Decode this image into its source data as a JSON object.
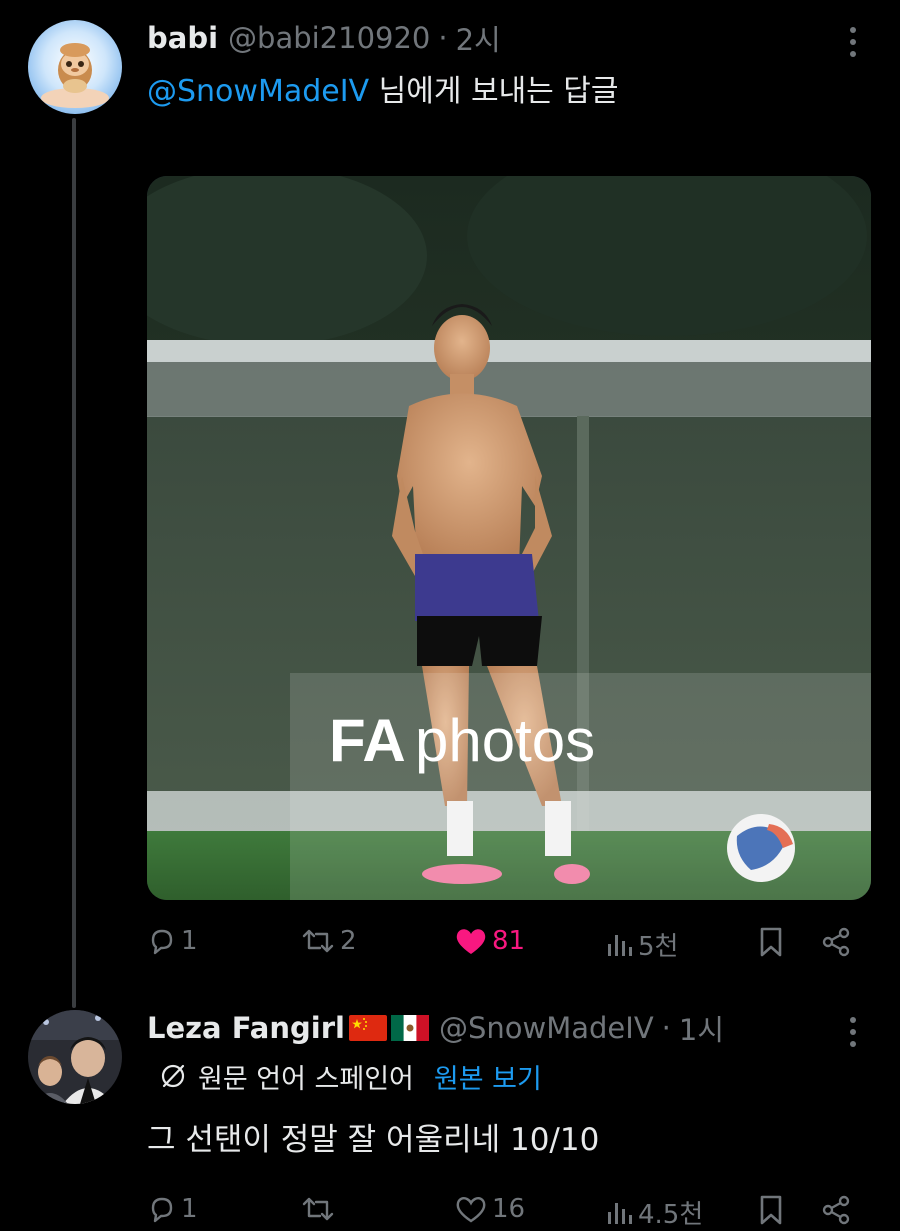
{
  "tweet1": {
    "display_name": "babi",
    "handle": "@babi210920",
    "separator": "·",
    "time": "2시",
    "reply_mention": "@SnowMadeIV",
    "reply_suffix": " 님에게 보내는 답글",
    "media": {
      "watermark_bold": "FA",
      "watermark_light": "photos"
    },
    "actions": {
      "replies": "1",
      "retweets": "2",
      "likes": "81",
      "views": "5천"
    }
  },
  "tweet2": {
    "display_name": "Leza Fangirl",
    "flags": [
      "china-flag-icon",
      "mexico-flag-icon"
    ],
    "handle": "@SnowMadeIV",
    "separator": "·",
    "time": "1시",
    "translate_note": "원문 언어 스페인어",
    "translate_link": "원본 보기",
    "text": "그 선탠이 정말 잘 어울리네 10/10",
    "actions": {
      "replies": "1",
      "retweets": "",
      "likes": "16",
      "views": "4.5천"
    }
  },
  "colors": {
    "background": "#000000",
    "primary_text": "#e7e9ea",
    "secondary_text": "#71767b",
    "link": "#1d9bf0",
    "like": "#f91880",
    "thread_line": "#3a3d40"
  }
}
